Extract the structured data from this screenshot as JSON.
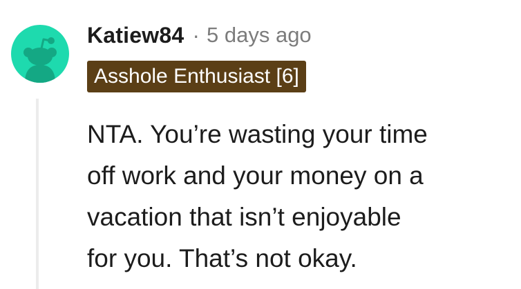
{
  "comment": {
    "username": "Katiew84",
    "separator": "·",
    "timestamp": "5 days ago",
    "flair": "Asshole Enthusiast [6]",
    "body_lines": [
      "NTA. You’re wasting your time",
      "off work and your money on a",
      "vacation that isn’t enjoyable",
      "for you. That’s not okay."
    ]
  },
  "avatar": {
    "icon": "snoo-avatar-icon",
    "background_color": "#1edaae"
  },
  "colors": {
    "flair_background": "#5b3f16",
    "flair_text": "#ffffff",
    "meta_text": "#7c7c7c",
    "thread_line": "#ececec"
  }
}
